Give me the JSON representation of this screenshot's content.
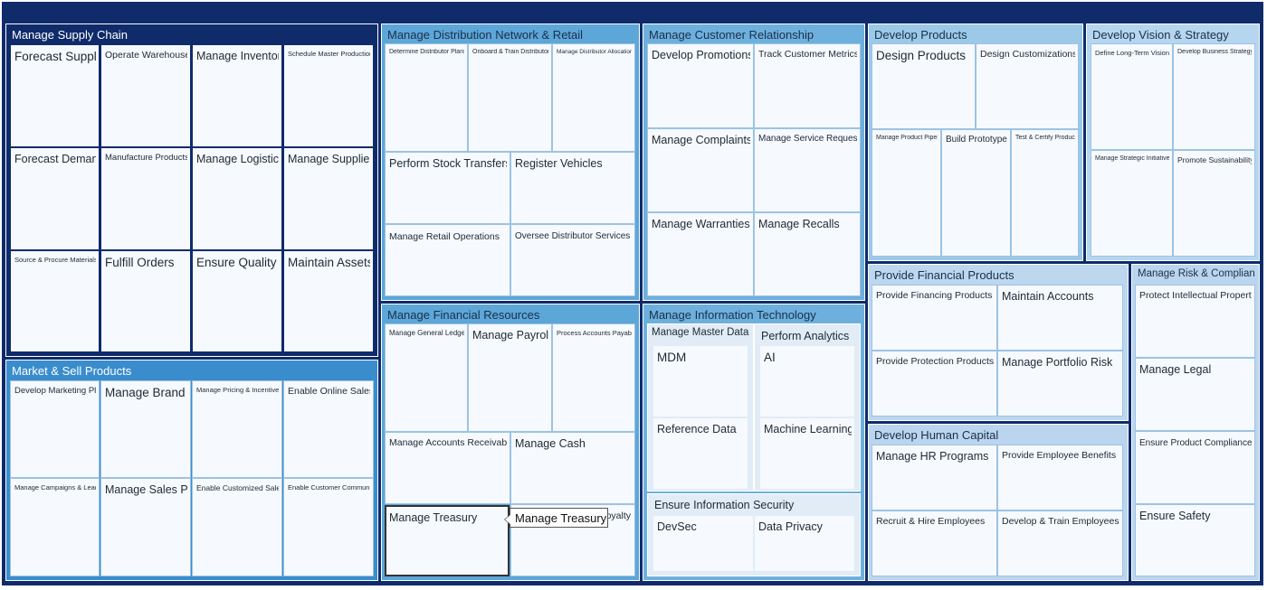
{
  "colors": {
    "frame": "#0f2b6a",
    "supply_chain": "#0f2b6a",
    "market_sell": "#3a8dcc",
    "distribution": "#5da6d8",
    "customer": "#6db0dd",
    "develop_products": "#9cc9e8",
    "vision": "#b6d6ef",
    "provide_financial": "#bdd7ef",
    "risk": "#bcd5ee",
    "hr": "#bcd5ee",
    "cell": "#f6f9fd"
  },
  "groups": {
    "supply_chain": {
      "title": "Manage Supply Chain",
      "cells": [
        "Forecast Supply",
        "Operate Warehouse",
        "Manage Inventory",
        "Schedule Master Production",
        "Forecast Demand",
        "Manufacture Products",
        "Manage Logistics",
        "Manage Suppliers",
        "Source & Procure Materials",
        "Fulfill Orders",
        "Ensure Quality",
        "Maintain Assets"
      ]
    },
    "market_sell": {
      "title": "Market & Sell Products",
      "cells": [
        "Develop Marketing Plan",
        "Manage Brand",
        "Manage Pricing & Incentives",
        "Enable Online Sales",
        "Manage Campaigns & Leads",
        "Manage Sales Plans",
        "Enable Customized Sales",
        "Enable Customer Community"
      ]
    },
    "distribution": {
      "title": "Manage Distribution Network & Retail",
      "cells": [
        "Determine Distributor Plans",
        "Onboard & Train Distributors",
        "Manage Distributor Allocations",
        "Perform Stock Transfers",
        "Register Vehicles",
        "Manage Retail Operations",
        "Oversee Distributor Services"
      ]
    },
    "financial_resources": {
      "title": "Manage Financial Resources",
      "cells": [
        "Manage General Ledger",
        "Manage Payroll",
        "Process Accounts Payable",
        "Manage Accounts Receivable",
        "Manage Cash",
        "Manage Treasury",
        "oyalty"
      ]
    },
    "customer": {
      "title": "Manage Customer Relationship",
      "cells": [
        "Develop Promotions",
        "Track Customer Metrics",
        "Manage Complaints",
        "Manage Service Requests",
        "Manage Warranties",
        "Manage Recalls"
      ]
    },
    "it": {
      "title": "Manage Information Technology",
      "subgroups": [
        {
          "title": "Manage Master Data",
          "cells": [
            "MDM",
            "Reference Data"
          ]
        },
        {
          "title": "Perform Analytics",
          "cells": [
            "AI",
            "Machine Learning"
          ]
        },
        {
          "title": "Ensure Information Security",
          "cells": [
            "DevSec",
            "Data Privacy"
          ]
        }
      ]
    },
    "develop_products": {
      "title": "Develop Products",
      "cells": [
        "Design Products",
        "Design Customizations",
        "Manage Product Pipeline",
        "Build Prototypes",
        "Test & Certify Products"
      ]
    },
    "vision": {
      "title": "Develop Vision & Strategy",
      "cells": [
        "Define Long-Term Vision",
        "Develop Business Strategy",
        "Manage Strategic Initiatives",
        "Promote Sustainability"
      ]
    },
    "financial_products": {
      "title": "Provide Financial Products",
      "cells": [
        "Provide Financing Products",
        "Maintain Accounts",
        "Provide Protection Products",
        "Manage Portfolio Risk"
      ]
    },
    "human_capital": {
      "title": "Develop Human Capital",
      "cells": [
        "Manage HR Programs",
        "Provide Employee Benefits",
        "Recruit & Hire Employees",
        "Develop & Train Employees"
      ]
    },
    "risk": {
      "title": "Manage Risk & Compliance",
      "cells": [
        "Protect Intellectual Property",
        "Manage Legal",
        "Ensure Product Compliance",
        "Ensure Safety"
      ]
    }
  },
  "tooltip": {
    "text": "Manage Treasury"
  }
}
